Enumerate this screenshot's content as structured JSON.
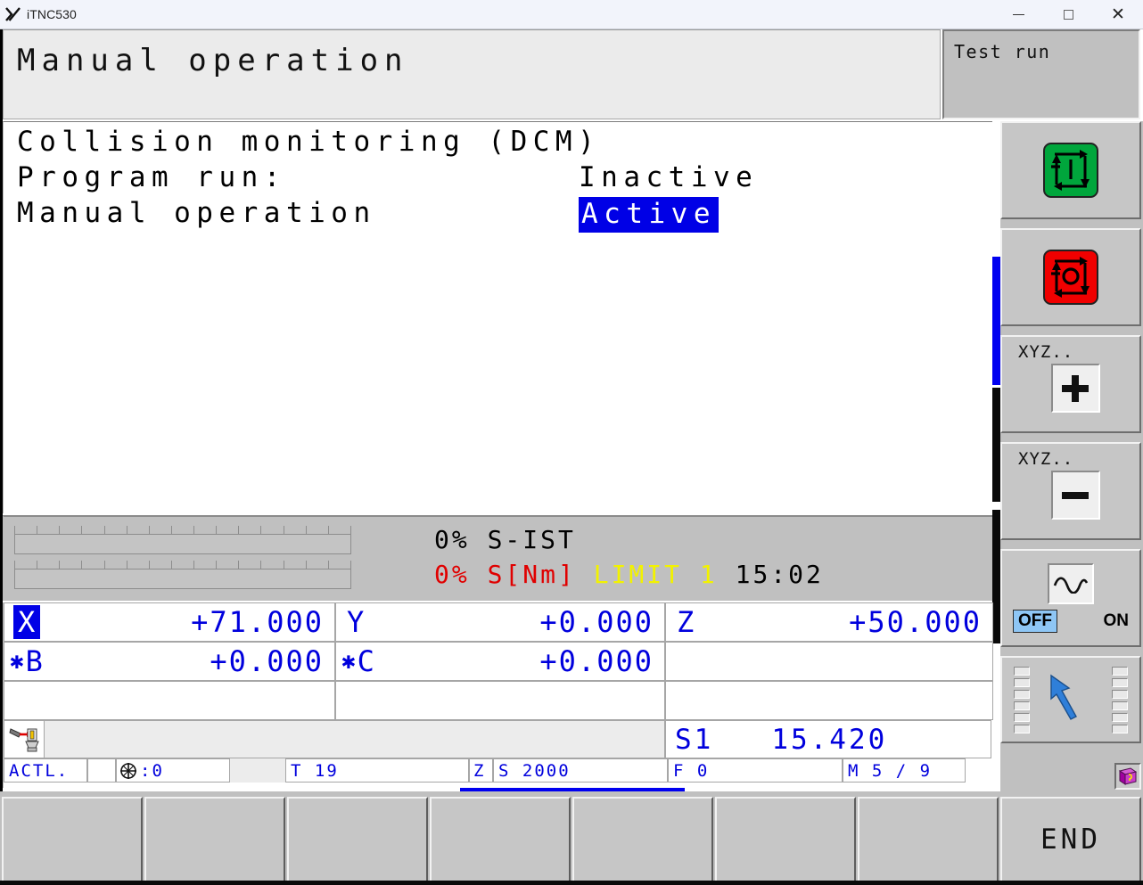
{
  "window": {
    "app_icon": "x-logo-icon",
    "title": "iTNC530",
    "minimize_label": "minimize",
    "maximize_label": "maximize",
    "close_label": "close"
  },
  "header": {
    "mode_title": "Manual operation",
    "secondary_mode": "Test run"
  },
  "workspace": {
    "heading": "Collision monitoring (DCM)",
    "rows": [
      {
        "label": "Program run:",
        "value": "Inactive",
        "highlighted": false
      },
      {
        "label": "Manual operation",
        "value": "Active",
        "highlighted": true
      }
    ],
    "highlight_bg": "#0000e6",
    "highlight_fg": "#ffffff"
  },
  "override": {
    "gauge_tick_count": 16,
    "row1": "0% S-IST",
    "spindle_percent": "0% S[Nm]",
    "limit": "LIMIT 1",
    "clock": "15:02",
    "colors": {
      "percent_red": "#e00000",
      "limit_yellow": "#f2f200",
      "clock_black": "#000000"
    }
  },
  "axes": {
    "value_color": "#0000dd",
    "row1": [
      {
        "label": "X",
        "value": "+71.000",
        "selected": true,
        "icon": ""
      },
      {
        "label": "Y",
        "value": "+0.000",
        "selected": false,
        "icon": ""
      },
      {
        "label": "Z",
        "value": "+50.000",
        "selected": false,
        "icon": ""
      }
    ],
    "row2": [
      {
        "label": "B",
        "value": "+0.000",
        "selected": false,
        "icon": "rotary-axis-icon"
      },
      {
        "label": "C",
        "value": "+0.000",
        "selected": false,
        "icon": "rotary-axis-icon"
      },
      {
        "label": "",
        "value": "",
        "selected": false,
        "icon": ""
      }
    ],
    "row3": [
      {
        "label": "",
        "value": "",
        "selected": false,
        "icon": ""
      },
      {
        "label": "",
        "value": "",
        "selected": false,
        "icon": ""
      },
      {
        "label": "",
        "value": "",
        "selected": false,
        "icon": ""
      }
    ],
    "spindle": "S1   15.420",
    "tool_icon": "tool-in-spindle-icon"
  },
  "status_fields": {
    "display_mode": "ACTL.",
    "blank": "",
    "datum_icon": "datum-crosshair-icon",
    "datum_value": ":0",
    "tool": "T 19",
    "tool_axis": "Z",
    "spindle_speed": "S 2000",
    "feed": "F 0",
    "m_functions": "M 5 / 9"
  },
  "softkeys_right": [
    {
      "name": "dcm-active-key",
      "type": "icon",
      "icon": "dcm-monitoring-on-icon",
      "color": "#00a63c",
      "label": ""
    },
    {
      "name": "dcm-inactive-key",
      "type": "icon",
      "icon": "dcm-monitoring-off-icon",
      "color": "#f00000",
      "label": ""
    },
    {
      "name": "axis-plus-key",
      "type": "plus",
      "icon": "plus-icon",
      "label": "XYZ.."
    },
    {
      "name": "axis-minus-key",
      "type": "minus",
      "icon": "minus-icon",
      "label": "XYZ.."
    },
    {
      "name": "handwheel-toggle-key",
      "type": "toggle",
      "icon": "wave-icon",
      "label": "",
      "off_label": "OFF",
      "on_label": "ON",
      "state": "OFF"
    },
    {
      "name": "softkey-navigation-key",
      "type": "nav",
      "icon": "softkey-nav-arrow-icon",
      "label": ""
    }
  ],
  "help_icon": "help-book-icon",
  "softkeys_bottom": [
    {
      "name": "softkey-1",
      "label": ""
    },
    {
      "name": "softkey-2",
      "label": ""
    },
    {
      "name": "softkey-3",
      "label": ""
    },
    {
      "name": "softkey-4",
      "label": ""
    },
    {
      "name": "softkey-5",
      "label": ""
    },
    {
      "name": "softkey-6",
      "label": ""
    },
    {
      "name": "softkey-7",
      "label": ""
    },
    {
      "name": "softkey-end",
      "label": "END"
    }
  ],
  "indicators": {
    "vertical_scroll_color": "#0000f0",
    "bottom_page_color": "#0000f0"
  }
}
